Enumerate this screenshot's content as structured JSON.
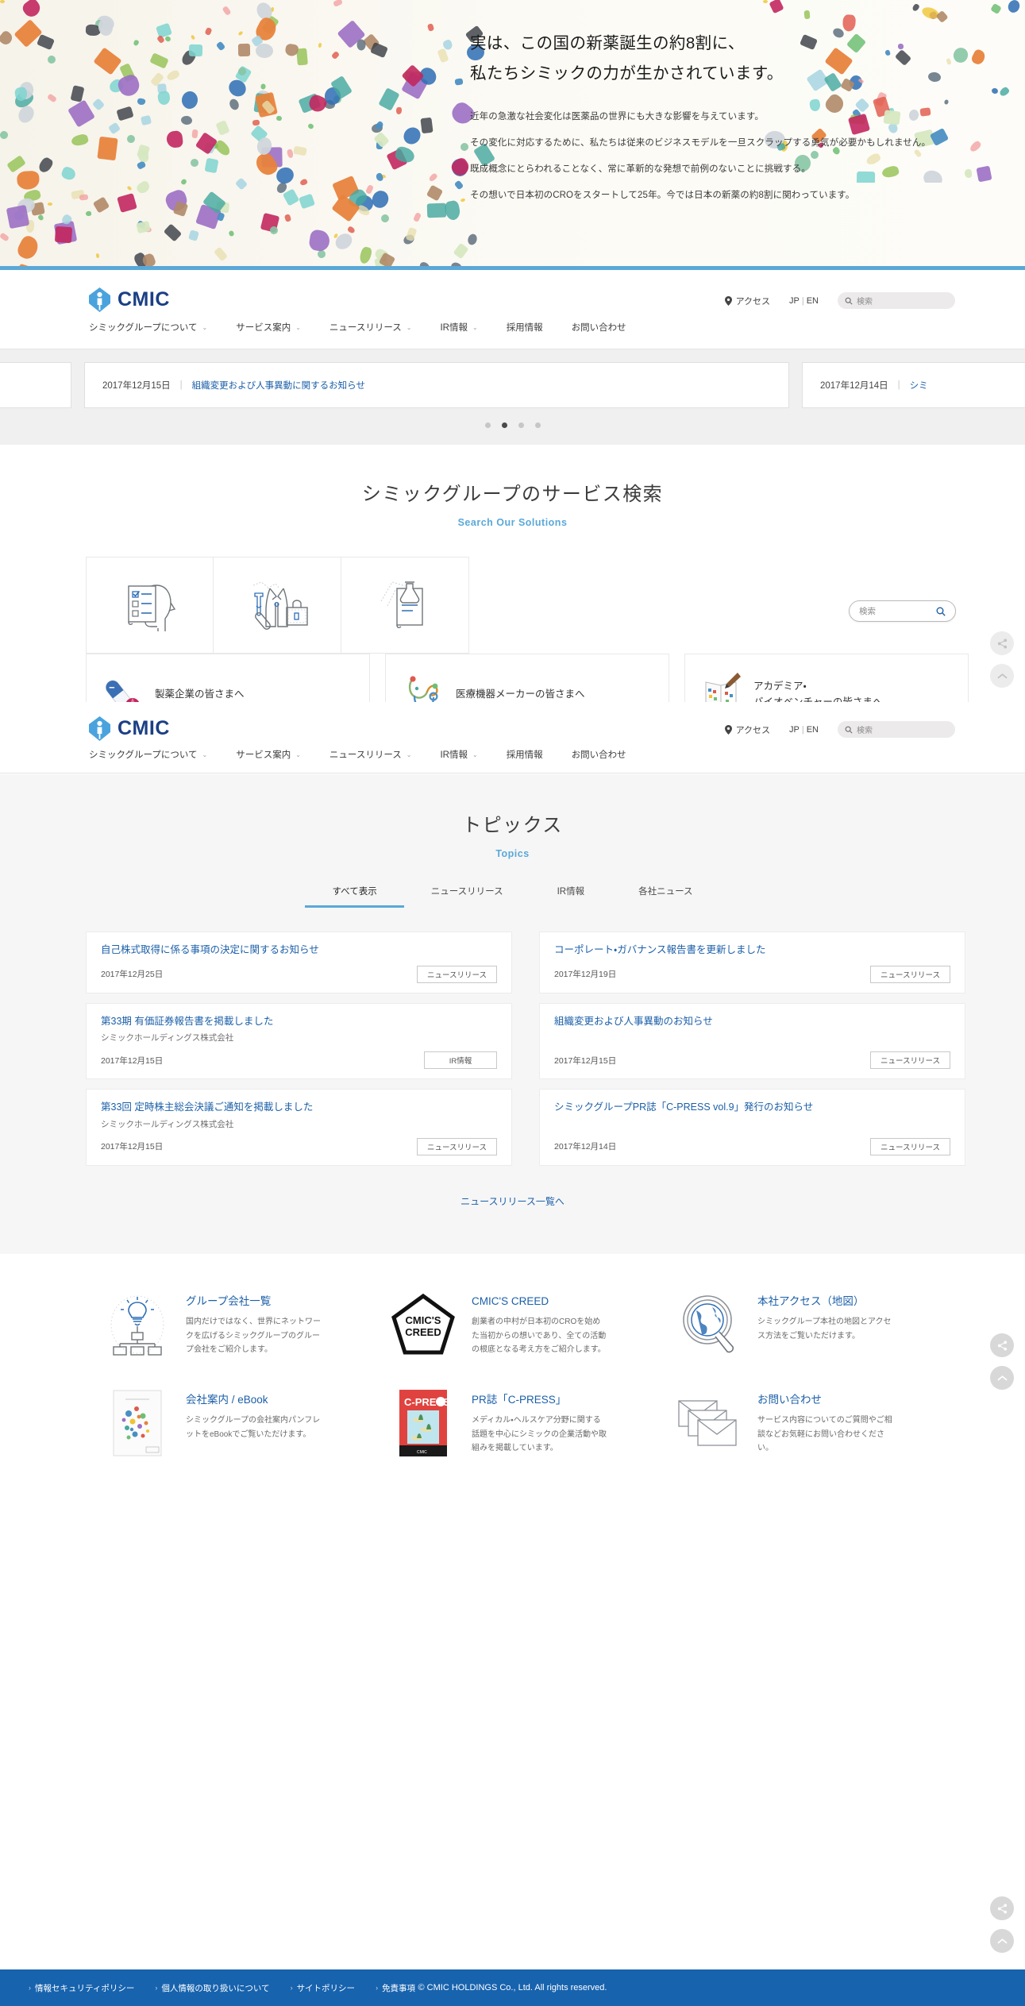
{
  "hero": {
    "headline_line1": "実は、この国の新薬誕生の約8割に、",
    "headline_line2": "私たちシミックの力が生かされています。",
    "paragraphs": [
      "近年の急激な社会変化は医薬品の世界にも大きな影響を与えています。",
      "その変化に対応するために、私たちは従来のビジネスモデルを一旦スクラップする勇気が必要かもしれません。",
      "既成概念にとらわれることなく、常に革新的な発想で前例のないことに挑戦する。",
      "その想いで日本初のCROをスタートして25年。今では日本の新薬の約8割に関わっています。"
    ]
  },
  "header": {
    "logo_text": "CMIC",
    "access_label": "アクセス",
    "lang_jp": "JP",
    "lang_sep": "|",
    "lang_en": "EN",
    "search_placeholder": "検索",
    "nav": [
      {
        "label": "シミックグループについて",
        "has_caret": true
      },
      {
        "label": "サービス案内",
        "has_caret": true
      },
      {
        "label": "ニュースリリース",
        "has_caret": true
      },
      {
        "label": "IR情報",
        "has_caret": true
      },
      {
        "label": "採用情報",
        "has_caret": false
      },
      {
        "label": "お問い合わせ",
        "has_caret": false
      }
    ]
  },
  "ticker": {
    "items": [
      {
        "date": "",
        "title": ""
      },
      {
        "date": "2017年12月15日",
        "title": "組織変更および人事異動に関するお知らせ"
      },
      {
        "date": "2017年12月14日",
        "title": "シミ"
      }
    ],
    "dots_count": 4,
    "active_dot": 1
  },
  "service_search": {
    "title": "シミックグループのサービス検索",
    "subtitle": "Search Our Solutions",
    "search_placeholder": "検索",
    "cards": [
      {
        "icon": "checklist-head-icon"
      },
      {
        "icon": "lab-coat-briefcase-icon"
      },
      {
        "icon": "document-flask-icon"
      }
    ]
  },
  "targets": [
    {
      "label": "製薬企業の皆さまへ",
      "icon": "capsule-icon"
    },
    {
      "label": "医療機器メーカーの皆さまへ",
      "icon": "stethoscope-icon"
    },
    {
      "label": "アカデミア・\nバイオベンチャーの皆さまへ",
      "icon": "open-book-icon"
    }
  ],
  "topics": {
    "title": "トピックス",
    "subtitle": "Topics",
    "tabs": [
      {
        "label": "すべて表示",
        "active": true
      },
      {
        "label": "ニュースリリース",
        "active": false
      },
      {
        "label": "IR情報",
        "active": false
      },
      {
        "label": "各社ニュース",
        "active": false
      }
    ],
    "news": [
      {
        "title": "自己株式取得に係る事項の決定に関するお知らせ",
        "corp": "",
        "date": "2017年12月25日",
        "tag": "ニュースリリース"
      },
      {
        "title": "コーポレート・ガバナンス報告書を更新しました",
        "corp": "",
        "date": "2017年12月19日",
        "tag": "ニュースリリース"
      },
      {
        "title": "第33期 有価証券報告書を掲載しました",
        "corp": "シミックホールディングス株式会社",
        "date": "2017年12月15日",
        "tag": "IR情報"
      },
      {
        "title": "組織変更および人事異動のお知らせ",
        "corp": "",
        "date": "2017年12月15日",
        "tag": "ニュースリリース"
      },
      {
        "title": "第33回 定時株主総会決議ご通知を掲載しました",
        "corp": "シミックホールディングス株式会社",
        "date": "2017年12月15日",
        "tag": "ニュースリリース"
      },
      {
        "title": "シミックグループPR誌「C-PRESS vol.9」発行のお知らせ",
        "corp": "",
        "date": "2017年12月14日",
        "tag": "ニュースリリース"
      }
    ],
    "more_label": "ニュースリリース一覧へ"
  },
  "tiles": [
    {
      "icon": "lightbulb-org-chart-icon",
      "title": "グループ会社一覧",
      "desc": "国内だけではなく、世界にネットワークを広げるシミックグループのグループ会社をご紹介します。"
    },
    {
      "icon": "cmics-creed-badge-icon",
      "title": "CMIC'S CREED",
      "desc": "創業者の中村が日本初のCROを始めた当初からの想いであり、全ての活動の根底となる考え方をご紹介します。"
    },
    {
      "icon": "globe-magnifier-icon",
      "title": "本社アクセス（地図）",
      "desc": "シミックグループ本社の地図とアクセス方法をご覧いただけます。"
    },
    {
      "icon": "brochure-cover-icon",
      "title": "会社案内 / eBook",
      "desc": "シミックグループの会社案内パンフレットをeBookでご覧いただけます。"
    },
    {
      "icon": "cpress-magazine-icon",
      "title": "PR誌「C-PRESS」",
      "desc": "メディカル・ヘルスケア分野に関する話題を中心にシミックの企業活動や取組みを掲載しています。"
    },
    {
      "icon": "envelopes-icon",
      "title": "お問い合わせ",
      "desc": "サービス内容についてのご質問やご相談などお気軽にお問い合わせください。"
    }
  ],
  "bottom_bar": {
    "links": [
      "情報セキュリティポリシー",
      "個人情報の取り扱いについて",
      "サイトポリシー",
      "免責事項"
    ],
    "copyright": "© CMIC HOLDINGS Co., Ltd. All rights reserved."
  },
  "fab": {
    "share_label": "share-icon",
    "top_label": "scroll-to-top-icon"
  },
  "colors": {
    "brand_blue": "#1b3f85",
    "accent_blue": "#5aa8d8",
    "link_blue": "#1b5fa8",
    "footer_blue": "#1763ae"
  }
}
